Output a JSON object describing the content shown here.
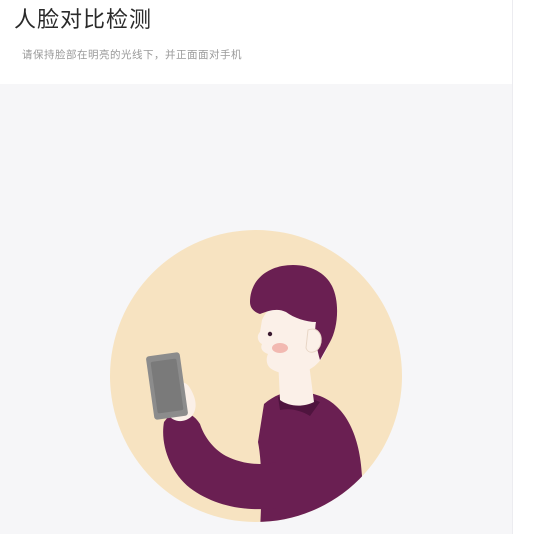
{
  "header": {
    "title": "人脸对比检测",
    "subtitle": "请保持脸部在明亮的光线下，并正面面对手机"
  },
  "illustration": {
    "icon": "face-scan-illustration-icon",
    "colors": {
      "circle": "#f7e3c1",
      "shirt": "#6a1f52",
      "hair": "#6a1f52",
      "skin": "#fbf0e8",
      "phone": "#8c8c8c",
      "cheek": "#f2b9b1"
    }
  }
}
